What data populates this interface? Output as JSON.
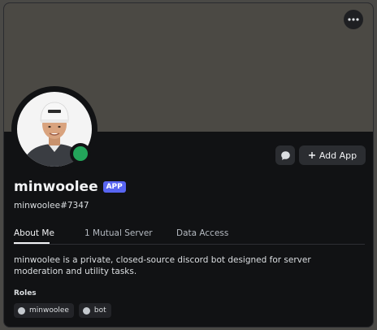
{
  "profile": {
    "display_name": "minwoolee",
    "badge": "APP",
    "username": "minwoolee#7347",
    "status": "online",
    "bio": "minwoolee is a private, closed-source discord bot designed for server moderation and utility tasks."
  },
  "actions": {
    "more_icon": "more-horizontal-icon",
    "message_icon": "message-bubble-icon",
    "add_app_label": "Add App"
  },
  "tabs": [
    {
      "label": "About Me",
      "active": true
    },
    {
      "label": "1 Mutual Server",
      "active": false
    },
    {
      "label": "Data Access",
      "active": false
    }
  ],
  "roles": {
    "title": "Roles",
    "items": [
      {
        "label": "minwoolee"
      },
      {
        "label": "bot"
      }
    ]
  },
  "colors": {
    "banner": "#4b4944",
    "card": "#111214",
    "status_online": "#23a55a",
    "badge": "#5865f2"
  }
}
